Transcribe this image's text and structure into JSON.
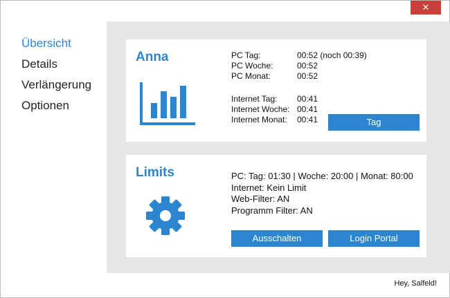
{
  "window": {
    "close_symbol": "✕"
  },
  "nav": {
    "items": [
      {
        "label": "Übersicht",
        "active": true
      },
      {
        "label": "Details"
      },
      {
        "label": "Verlängerung"
      },
      {
        "label": "Optionen"
      }
    ]
  },
  "user_card": {
    "name": "Anna",
    "icon": "bar-chart-icon",
    "pc_stats": [
      {
        "label": "PC Tag:",
        "value": "00:52 (noch 00:39)"
      },
      {
        "label": "PC Woche:",
        "value": "00:52"
      },
      {
        "label": "PC Monat:",
        "value": "00:52"
      }
    ],
    "internet_stats": [
      {
        "label": "Internet Tag:",
        "value": "00:41"
      },
      {
        "label": "Internet Woche:",
        "value": "00:41"
      },
      {
        "label": "Internet Monat:",
        "value": "00:41"
      }
    ],
    "button_label": "Tag"
  },
  "limits_card": {
    "title": "Limits",
    "icon": "gear-icon",
    "lines": [
      "PC: Tag: 01:30 | Woche: 20:00 | Monat: 80:00",
      "Internet: Kein Limit",
      "Web-Filter: AN",
      "Programm Filter: AN"
    ],
    "buttons": {
      "disable": "Ausschalten",
      "login": "Login Portal"
    }
  },
  "footer": {
    "text": "Hey, Salfeld!"
  },
  "colors": {
    "accent": "#2b86cf",
    "close": "#c7403a",
    "panel_bg": "#e6e6e6"
  }
}
